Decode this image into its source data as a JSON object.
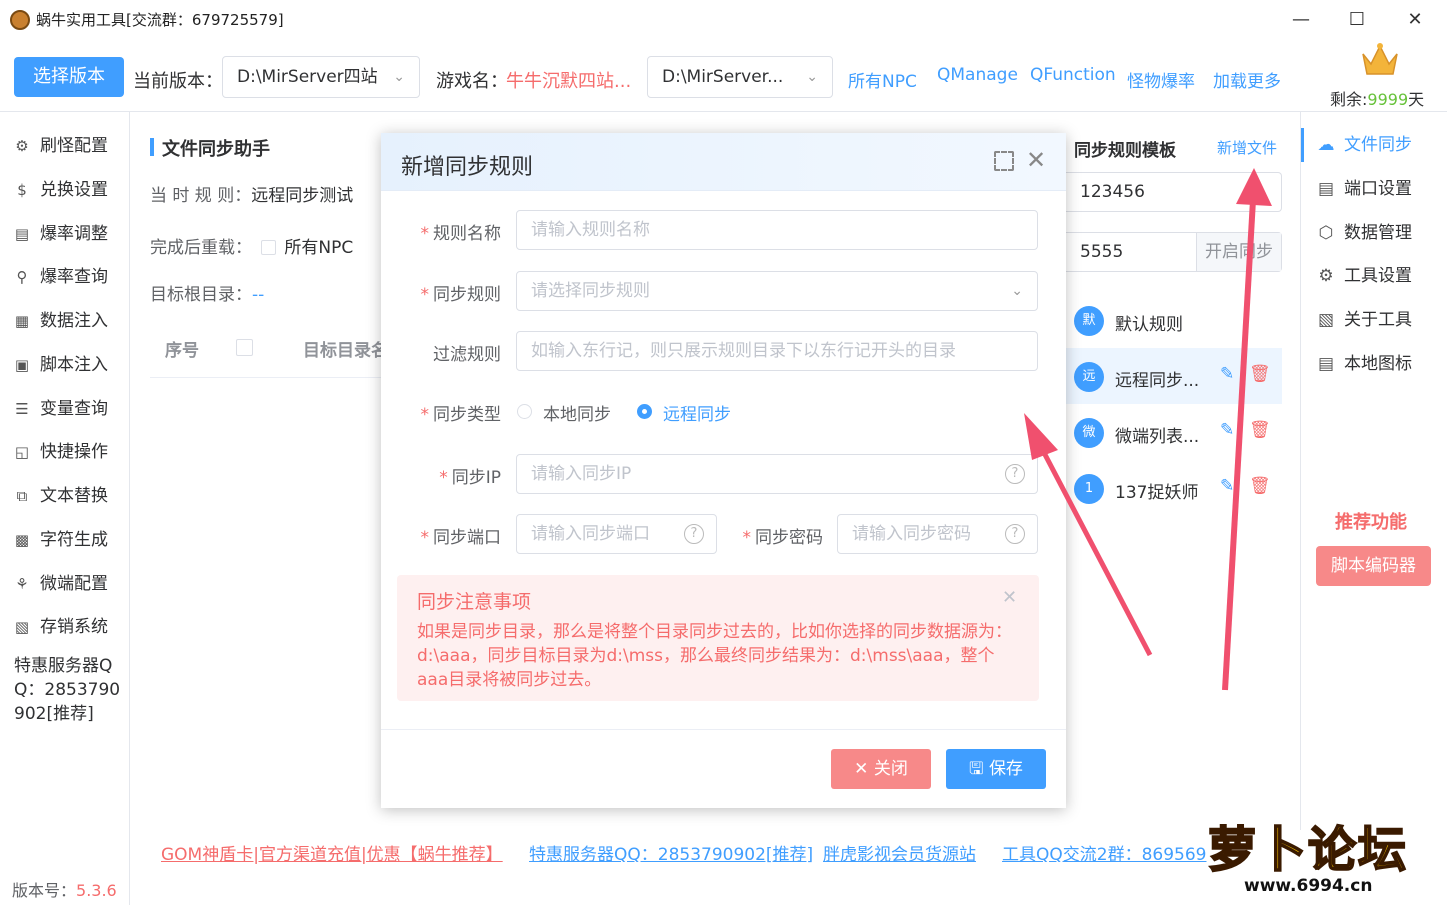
{
  "window": {
    "title": "蜗牛实用工具[交流群：679725579]"
  },
  "toolbar": {
    "choose_version_label": "选择版本",
    "current_version_label": "当前版本：",
    "current_version_value": "D:\\MirServer四站",
    "game_name_label": "游戏名：",
    "game_name_value": "牛牛沉默四站...",
    "path_select_value": "D:\\MirServer...",
    "links": [
      "所有NPC",
      "QManage",
      "QFunction",
      "怪物爆率",
      "加载更多"
    ],
    "remaining_label": "剩余:",
    "remaining_value": "9999",
    "remaining_unit": "天"
  },
  "sidebar": {
    "items": [
      {
        "label": "刷怪配置",
        "icon": "monster-icon"
      },
      {
        "label": "兑换设置",
        "icon": "dollar-icon"
      },
      {
        "label": "爆率调整",
        "icon": "cube-icon"
      },
      {
        "label": "爆率查询",
        "icon": "search-icon"
      },
      {
        "label": "数据注入",
        "icon": "grid-icon"
      },
      {
        "label": "脚本注入",
        "icon": "script-icon"
      },
      {
        "label": "变量查询",
        "icon": "variable-icon"
      },
      {
        "label": "快捷操作",
        "icon": "folder-icon"
      },
      {
        "label": "文本替换",
        "icon": "replace-icon"
      },
      {
        "label": "字符生成",
        "icon": "lock-icon"
      },
      {
        "label": "微端配置",
        "icon": "microscope-icon"
      },
      {
        "label": "存销系统",
        "icon": "archive-icon"
      }
    ],
    "promo_text": "特惠服务器QQ：2853790902[推荐]",
    "version_label": "版本号：",
    "version_value": "5.3.6"
  },
  "main": {
    "section_title": "文件同步助手",
    "current_rule_label": "当 时 规 则：",
    "current_rule_value": "远程同步测试",
    "reload_label": "完成后重载：",
    "reload_option": "所有NPC",
    "target_dir_label": "目标根目录：",
    "target_dir_value": "--",
    "table_headers": [
      "序号",
      "目标目录名"
    ]
  },
  "rules_panel": {
    "title": "同步规则模板",
    "add_file_link": "新增文件",
    "input1_value": "123456",
    "input2_value": "5555",
    "start_sync_label": "开启同步",
    "rules": [
      {
        "avatar": "默",
        "name": "默认规则"
      },
      {
        "avatar": "远",
        "name": "远程同步..."
      },
      {
        "avatar": "微",
        "name": "微端列表..."
      },
      {
        "avatar": "1",
        "name": "137捉妖师"
      }
    ]
  },
  "right_sidebar": {
    "items": [
      {
        "label": "文件同步",
        "icon": "sync-icon"
      },
      {
        "label": "端口设置",
        "icon": "port-icon"
      },
      {
        "label": "数据管理",
        "icon": "cube-icon"
      },
      {
        "label": "工具设置",
        "icon": "gear-icon"
      },
      {
        "label": "关于工具",
        "icon": "clipboard-icon"
      },
      {
        "label": "本地图标",
        "icon": "document-icon"
      }
    ],
    "recommend_title": "推荐功能",
    "script_encoder_label": "脚本编码器"
  },
  "modal": {
    "title": "新增同步规则",
    "rule_name_label": "规则名称",
    "rule_name_placeholder": "请输入规则名称",
    "sync_rule_label": "同步规则",
    "sync_rule_placeholder": "请选择同步规则",
    "filter_label": "过滤规则",
    "filter_placeholder": "如输入东行记，则只展示规则目录下以东行记开头的目录",
    "sync_type_label": "同步类型",
    "sync_type_options": [
      "本地同步",
      "远程同步"
    ],
    "sync_type_selected": "远程同步",
    "sync_ip_label": "同步IP",
    "sync_ip_placeholder": "请输入同步IP",
    "sync_port_label": "同步端口",
    "sync_port_placeholder": "请输入同步端口",
    "sync_password_label": "同步密码",
    "sync_password_placeholder": "请输入同步密码",
    "notice_title": "同步注意事项",
    "notice_text": "如果是同步目录，那么是将整个目录同步过去的，比如你选择的同步数据源为：d:\\aaa，同步目标目录为d:\\mss，那么最终同步结果为：d:\\mss\\aaa，整个aaa目录将被同步过去。",
    "close_button": "关闭",
    "save_button": "保存"
  },
  "footer": {
    "links": [
      "GOM神盾卡|官方渠道充值|优惠【蜗牛推荐】",
      "特惠服务器QQ：2853790902[推荐]",
      "胖虎影视会员货源站",
      "工具QQ交流2群：869569"
    ]
  },
  "watermark": {
    "text": "蜗牛实用工具 679725579",
    "logo_text": "萝卜论坛",
    "logo_url": "www.6994.cn"
  },
  "colors": {
    "primary": "#409eff",
    "danger": "#f56c6c",
    "arrow": "#f0506e",
    "remain": "#67c23a"
  }
}
